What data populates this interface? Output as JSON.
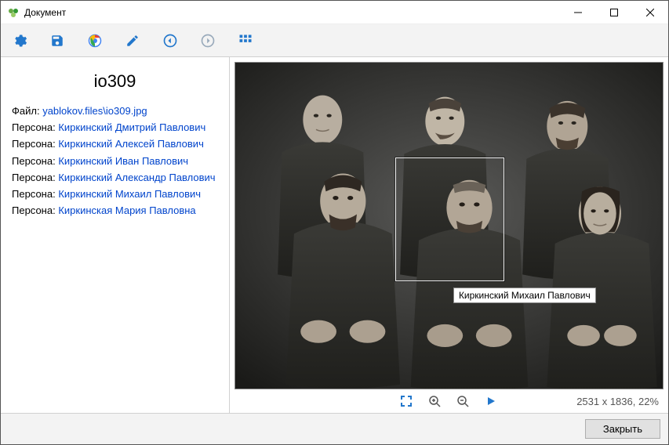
{
  "window": {
    "title": "Документ"
  },
  "document": {
    "title": "io309",
    "file_label": "Файл:",
    "file_link": "yablokov.files\\io309.jpg",
    "person_label": "Персона:",
    "persons": [
      "Киркинский Дмитрий Павлович",
      "Киркинский Алексей Павлович",
      "Киркинский Иван Павлович",
      "Киркинский Александр Павлович",
      "Киркинский Михаил Павлович",
      "Киркинская Мария Павловна"
    ]
  },
  "viewer": {
    "selected_person": "Киркинский Михаил Павлович",
    "status": "2531 x 1836, 22%"
  },
  "footer": {
    "close": "Закрыть"
  }
}
